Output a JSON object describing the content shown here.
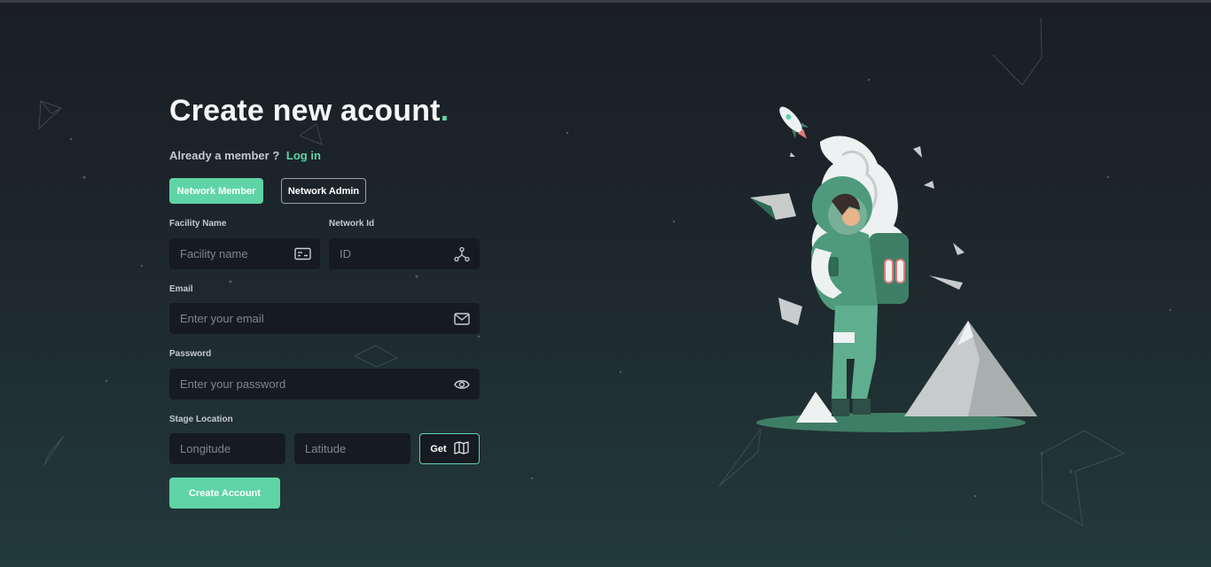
{
  "page": {
    "title": "Create new acount",
    "title_dot": "."
  },
  "auth": {
    "member_prompt": "Already a member ?",
    "login_label": "Log in"
  },
  "roles": {
    "member_label": "Network Member",
    "admin_label": "Network Admin",
    "selected": "Network Member"
  },
  "form": {
    "facility": {
      "label": "Facility Name",
      "placeholder": "Facility name",
      "icon": "id-card-icon"
    },
    "network_id": {
      "label": "Network Id",
      "placeholder": "ID",
      "icon": "network-icon"
    },
    "email": {
      "label": "Email",
      "placeholder": "Enter your email",
      "icon": "mail-icon"
    },
    "password": {
      "label": "Password",
      "placeholder": "Enter your password",
      "icon": "eye-icon"
    },
    "location": {
      "label": "Stage Location",
      "longitude_placeholder": "Longitude",
      "latitude_placeholder": "Latitude",
      "get_label": "Get",
      "get_icon": "map-icon"
    },
    "submit_label": "Create Account"
  },
  "colors": {
    "accent": "#5fd4a7",
    "background_top": "#1a1e24",
    "background_bottom": "#223a3b",
    "field_bg": "#161b21"
  }
}
